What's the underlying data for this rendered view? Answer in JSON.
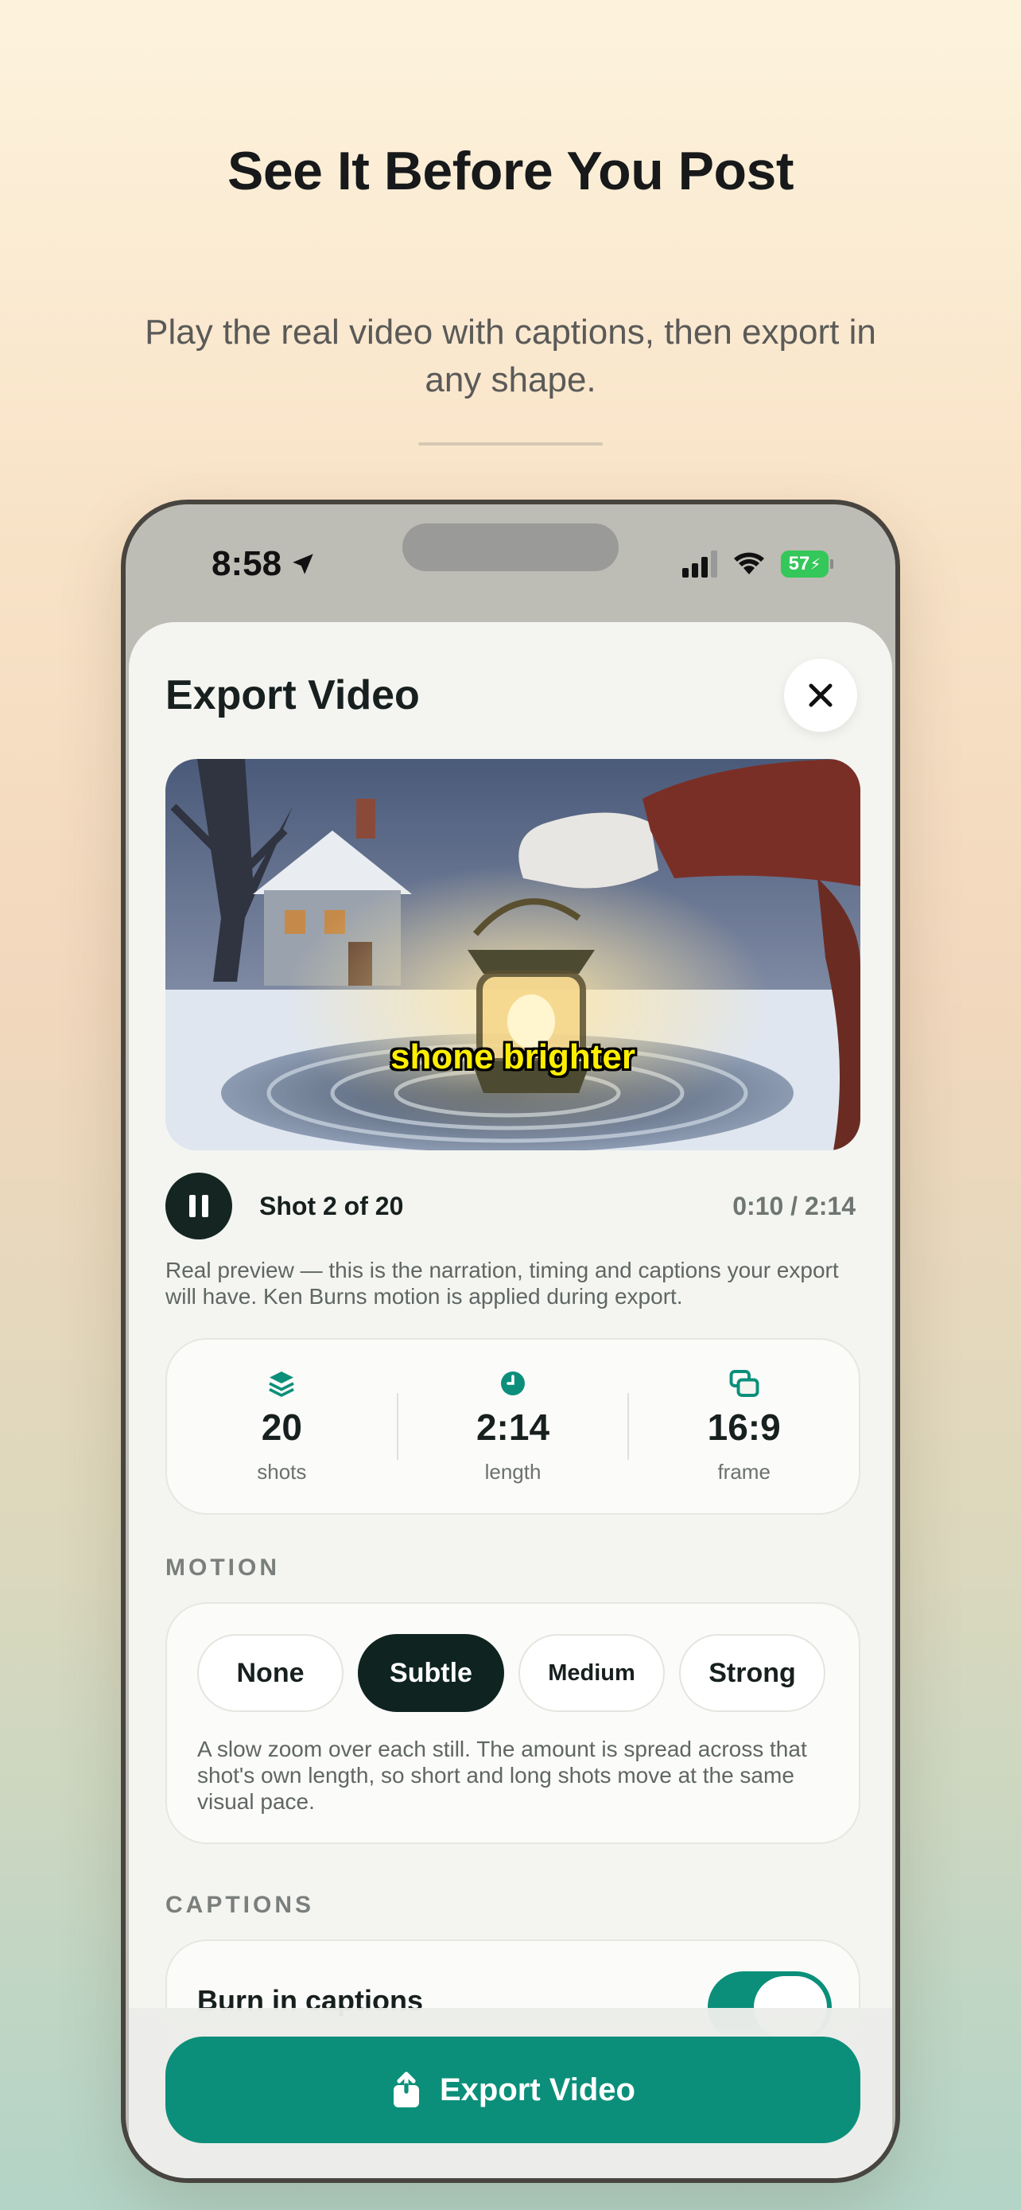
{
  "promo": {
    "headline": "See It Before You Post",
    "subhead": "Play the real video with captions, then export in any shape."
  },
  "status_bar": {
    "time": "8:58",
    "battery": "57"
  },
  "sheet": {
    "title": "Export Video",
    "video_caption": "shone brighter",
    "shot_label": "Shot 2 of 20",
    "time_label": "0:10 / 2:14",
    "preview_note": "Real preview — this is the narration, timing and captions your export will have. Ken Burns motion is applied during export."
  },
  "stats": [
    {
      "value": "20",
      "caption": "shots",
      "icon": "layers-icon"
    },
    {
      "value": "2:14",
      "caption": "length",
      "icon": "clock-icon"
    },
    {
      "value": "16:9",
      "caption": "frame",
      "icon": "frame-icon"
    }
  ],
  "motion": {
    "section_label": "MOTION",
    "options": [
      "None",
      "Subtle",
      "Medium",
      "Strong"
    ],
    "selected": "Subtle",
    "description": "A slow zoom over each still. The amount is spread across that shot's own length, so short and long shots move at the same visual pace."
  },
  "captions": {
    "section_label": "CAPTIONS",
    "burn_in_label": "Burn in captions",
    "burn_in_enabled": true
  },
  "export_button": {
    "label": "Export Video"
  },
  "colors": {
    "accent": "#0b8f7a",
    "dark": "#0f2420",
    "caption_yellow": "#ffee00",
    "battery_green": "#34c759"
  }
}
